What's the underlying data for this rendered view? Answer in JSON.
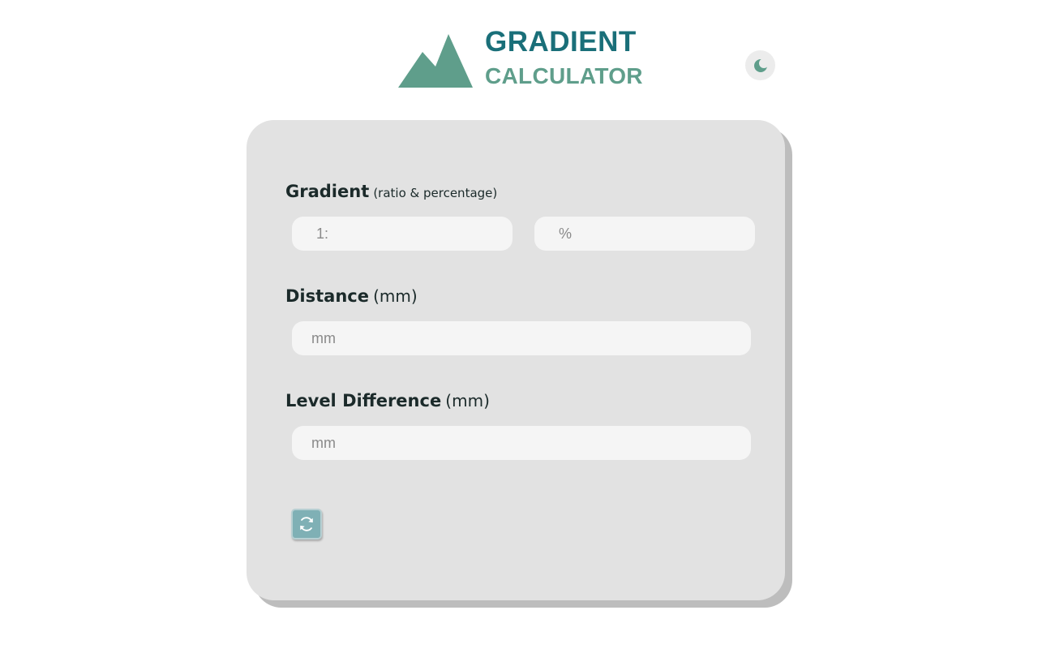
{
  "colors": {
    "brand_dark": "#1a6f79",
    "brand_light": "#5f9e8b",
    "card_bg": "#e2e2e2",
    "input_bg": "#f5f5f5",
    "button_bg": "#7fb0b5"
  },
  "header": {
    "title": "GRADIENT",
    "subtitle": "CALCULATOR",
    "logo_icon": "mountain-icon",
    "theme_toggle_icon": "moon-icon"
  },
  "form": {
    "gradient": {
      "label": "Gradient",
      "unit": "(ratio & percentage)",
      "ratio_placeholder": "1:",
      "ratio_value": "",
      "percent_placeholder": "%",
      "percent_value": ""
    },
    "distance": {
      "label": "Distance",
      "unit": "(mm)",
      "placeholder": "mm",
      "value": ""
    },
    "level_difference": {
      "label": "Level Difference",
      "unit": "(mm)",
      "placeholder": "mm",
      "value": ""
    },
    "reset_icon": "refresh-icon"
  }
}
